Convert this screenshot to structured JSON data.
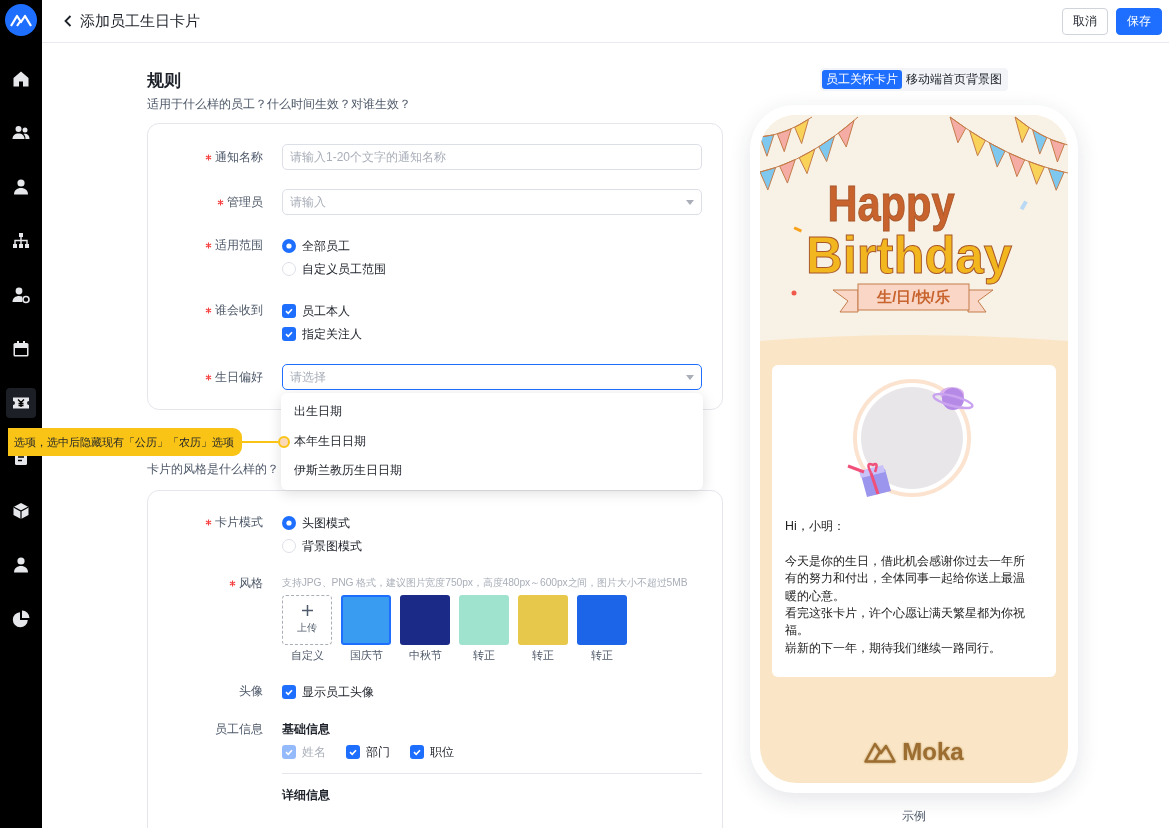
{
  "sidebar": {
    "items": [
      {
        "kind": "home",
        "selected": false
      },
      {
        "kind": "team",
        "selected": false
      },
      {
        "kind": "person",
        "selected": false
      },
      {
        "kind": "org",
        "selected": false
      },
      {
        "kind": "person-gear",
        "selected": false
      },
      {
        "kind": "calendar",
        "selected": false
      },
      {
        "kind": "ticket",
        "selected": true
      },
      {
        "kind": "clipboard",
        "selected": false
      },
      {
        "kind": "cube",
        "selected": false
      },
      {
        "kind": "person",
        "selected": false
      },
      {
        "kind": "pie",
        "selected": false
      }
    ]
  },
  "header": {
    "title": "添加员工生日卡片",
    "buttons": [
      {
        "label": "取消",
        "kind": "secondary"
      },
      {
        "label": "保存",
        "kind": "primary"
      }
    ]
  },
  "rules": {
    "title": "规则",
    "subtitle": "适用于什么样的员工？什么时间生效？对谁生效？",
    "fields": [
      {
        "kind": "text",
        "label": "通知名称",
        "required": true,
        "placeholder": "请输入1-20个文字的通知名称"
      },
      {
        "kind": "select",
        "label": "管理员",
        "required": true,
        "placeholder": "请输入",
        "open": false
      },
      {
        "kind": "radio",
        "label": "适用范围",
        "required": true,
        "options": [
          {
            "label": "全部员工",
            "selected": true
          },
          {
            "label": "自定义员工范围",
            "selected": false
          }
        ]
      },
      {
        "kind": "checkbox",
        "label": "谁会收到",
        "required": true,
        "options": [
          {
            "label": "员工本人",
            "checked": true,
            "disabled": false
          },
          {
            "label": "指定关注人",
            "checked": true,
            "disabled": false
          }
        ]
      },
      {
        "kind": "select",
        "label": "生日偏好",
        "required": true,
        "placeholder": "请选择",
        "open": true,
        "options": [
          {
            "label": "出生日期"
          },
          {
            "label": "本年生日日期",
            "note": "选项，选中后隐藏现有「公历」「农历」选项"
          },
          {
            "label": "伊斯兰教历生日日期"
          }
        ]
      }
    ]
  },
  "style": {
    "subtitle": "卡片的风格是什么样的？",
    "fields": [
      {
        "kind": "radio",
        "label": "卡片模式",
        "required": true,
        "options": [
          {
            "label": "头图模式",
            "selected": true
          },
          {
            "label": "背景图模式",
            "selected": false
          }
        ]
      },
      {
        "kind": "gallery",
        "label": "风格",
        "required": true,
        "hint": "支持JPG、PNG 格式，建议图片宽度750px，高度480px～600px之间，图片大小不超过5MB",
        "upload": {
          "label": "上传",
          "caption": "自定义"
        },
        "templates": [
          {
            "caption": "国庆节",
            "color": "#3a9cf0",
            "selected": true
          },
          {
            "caption": "中秋节",
            "color": "#1b2a86",
            "selected": false
          },
          {
            "caption": "转正",
            "color": "#9fe3cf",
            "selected": false
          },
          {
            "caption": "转正",
            "color": "#e7c84a",
            "selected": false
          },
          {
            "caption": "转正",
            "color": "#1c64e8",
            "selected": false
          }
        ]
      },
      {
        "kind": "checkbox",
        "label": "头像",
        "options": [
          {
            "label": "显示员工头像",
            "checked": true,
            "disabled": false
          }
        ]
      },
      {
        "kind": "groups",
        "label": "员工信息",
        "groups": [
          {
            "title": "基础信息",
            "options": [
              {
                "label": "姓名",
                "checked": true,
                "disabled": true
              },
              {
                "label": "部门",
                "checked": true,
                "disabled": false
              },
              {
                "label": "职位",
                "checked": true,
                "disabled": false
              }
            ]
          },
          {
            "title": "详细信息"
          }
        ]
      }
    ]
  },
  "preview": {
    "tabs": [
      {
        "label": "员工关怀卡片",
        "selected": true
      },
      {
        "label": "移动端首页背景图",
        "selected": false
      }
    ],
    "card": {
      "headline": [
        "Happy",
        "Birthday"
      ],
      "banner": "生/日/快/乐",
      "greeting": "Hi，小明：",
      "paragraphs": [
        "今天是你的生日，借此机会感谢你过去一年所有的努力和付出，全体同事一起给你送上最温暖的心意。",
        "看完这张卡片，许个心愿让满天繁星都为你祝福。",
        "崭新的下一年，期待我们继续一路同行。"
      ],
      "brand": "Moka"
    },
    "caption": "示例"
  }
}
